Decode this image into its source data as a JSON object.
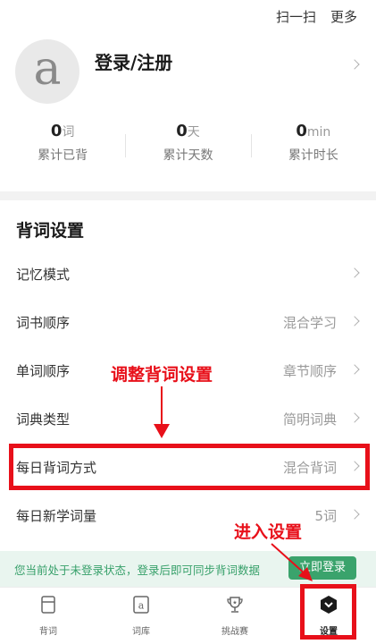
{
  "topbar": {
    "scan_label": "扫一扫",
    "more_label": "更多"
  },
  "profile": {
    "avatar_letter": "a",
    "login_label": "登录/注册"
  },
  "stats": [
    {
      "value": "0",
      "unit": "词",
      "label": "累计已背"
    },
    {
      "value": "0",
      "unit": "天",
      "label": "累计天数"
    },
    {
      "value": "0",
      "unit": "min",
      "label": "累计时长"
    }
  ],
  "settings": {
    "title": "背词设置",
    "rows": [
      {
        "label": "记忆模式",
        "value": ""
      },
      {
        "label": "词书顺序",
        "value": "混合学习"
      },
      {
        "label": "单词顺序",
        "value": "章节顺序"
      },
      {
        "label": "词典类型",
        "value": "简明词典"
      },
      {
        "label": "每日背词方式",
        "value": "混合背词"
      },
      {
        "label": "每日新学词量",
        "value": "5词"
      }
    ]
  },
  "annotations": {
    "adjust": "调整背词设置",
    "enter": "进入设置"
  },
  "banner": {
    "text": "您当前处于未登录状态，登录后即可同步背词数据",
    "button": "立即登录"
  },
  "tabs": [
    {
      "label": "背词",
      "icon": "book-icon"
    },
    {
      "label": "词库",
      "icon": "dictionary-icon"
    },
    {
      "label": "挑战赛",
      "icon": "trophy-icon"
    },
    {
      "label": "设置",
      "icon": "settings-icon"
    }
  ],
  "colors": {
    "accent": "#3aa36c",
    "annotation": "#e8101a"
  }
}
